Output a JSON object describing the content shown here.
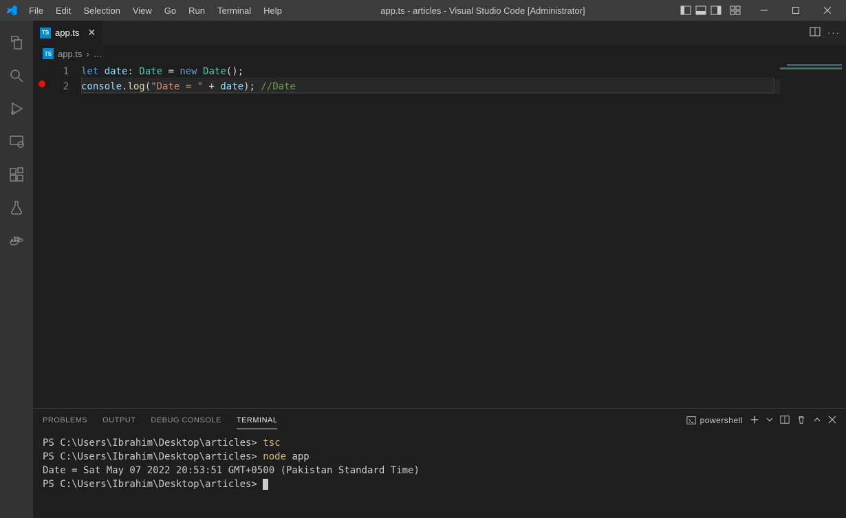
{
  "title": "app.ts - articles - Visual Studio Code [Administrator]",
  "menu": [
    "File",
    "Edit",
    "Selection",
    "View",
    "Go",
    "Run",
    "Terminal",
    "Help"
  ],
  "tab": {
    "label": "app.ts"
  },
  "breadcrumb": {
    "file": "app.ts",
    "rest": "…"
  },
  "code": {
    "lines": [
      {
        "num": "1",
        "tokens": [
          {
            "t": "let ",
            "c": "kw"
          },
          {
            "t": "date",
            "c": "var"
          },
          {
            "t": ": ",
            "c": "punct"
          },
          {
            "t": "Date",
            "c": "type"
          },
          {
            "t": " = ",
            "c": "op"
          },
          {
            "t": "new",
            "c": "kw"
          },
          {
            "t": " ",
            "c": "op"
          },
          {
            "t": "Date",
            "c": "type"
          },
          {
            "t": "();",
            "c": "punct"
          }
        ]
      },
      {
        "num": "2",
        "tokens": [
          {
            "t": "console",
            "c": "var"
          },
          {
            "t": ".",
            "c": "punct"
          },
          {
            "t": "log",
            "c": "fn"
          },
          {
            "t": "(",
            "c": "punct"
          },
          {
            "t": "\"Date = \"",
            "c": "str"
          },
          {
            "t": " + ",
            "c": "op"
          },
          {
            "t": "date",
            "c": "var"
          },
          {
            "t": "); ",
            "c": "punct"
          },
          {
            "t": "//Date",
            "c": "cmt"
          }
        ]
      }
    ],
    "current_line": 2
  },
  "panel": {
    "tabs": [
      "PROBLEMS",
      "OUTPUT",
      "DEBUG CONSOLE",
      "TERMINAL"
    ],
    "active": "TERMINAL",
    "shell": "powershell"
  },
  "terminal": [
    {
      "segs": [
        {
          "t": "PS C:\\Users\\Ibrahim\\Desktop\\articles> "
        },
        {
          "t": "tsc",
          "c": "term-yellow"
        }
      ]
    },
    {
      "segs": [
        {
          "t": "PS C:\\Users\\Ibrahim\\Desktop\\articles> "
        },
        {
          "t": "node",
          "c": "term-yellow"
        },
        {
          "t": " app"
        }
      ]
    },
    {
      "segs": [
        {
          "t": "Date = Sat May 07 2022 20:53:51 GMT+0500 (Pakistan Standard Time)"
        }
      ]
    },
    {
      "segs": [
        {
          "t": "PS C:\\Users\\Ibrahim\\Desktop\\articles> "
        }
      ],
      "cursor": true
    }
  ]
}
